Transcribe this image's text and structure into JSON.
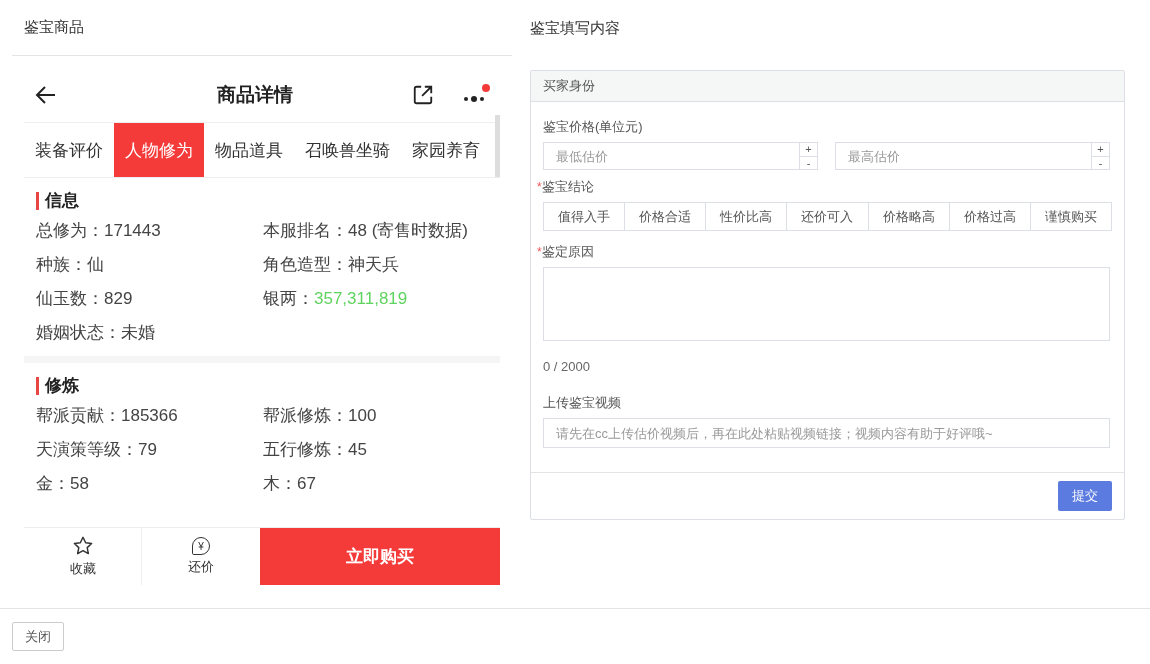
{
  "left_panel": {
    "title": "鉴宝商品"
  },
  "phone": {
    "title": "商品详情",
    "more_badge": true,
    "tabs": [
      {
        "label": "装备评价",
        "selected": false
      },
      {
        "label": "人物修为",
        "selected": true
      },
      {
        "label": "物品道具",
        "selected": false
      },
      {
        "label": "召唤兽坐骑",
        "selected": false
      },
      {
        "label": "家园养育",
        "selected": false
      }
    ],
    "sections": [
      {
        "title": "信息",
        "items": [
          {
            "label": "总修为：",
            "value": "171443"
          },
          {
            "label": "本服排名：",
            "value": "48 (寄售时数据)"
          },
          {
            "label": "种族：",
            "value": "仙"
          },
          {
            "label": "角色造型：",
            "value": "神天兵"
          },
          {
            "label": "仙玉数：",
            "value": "829"
          },
          {
            "label": "银两：",
            "value": "357,311,819",
            "color": "#5fd35f"
          },
          {
            "label": "婚姻状态：",
            "value": "未婚"
          }
        ]
      },
      {
        "title": "修炼",
        "items": [
          {
            "label": "帮派贡献：",
            "value": "185366"
          },
          {
            "label": "帮派修炼：",
            "value": "100"
          },
          {
            "label": "天演策等级：",
            "value": "79"
          },
          {
            "label": "五行修炼：",
            "value": "45"
          },
          {
            "label": "金：",
            "value": "58"
          },
          {
            "label": "木：",
            "value": "67"
          }
        ]
      }
    ],
    "actions": [
      {
        "kind": "favorite",
        "label": "收藏"
      },
      {
        "kind": "bargain",
        "label": "还价",
        "symbol": "¥"
      }
    ],
    "buy_button": "立即购买"
  },
  "right_panel": {
    "title": "鉴宝填写内容",
    "card": {
      "header": "买家身份",
      "price": {
        "label": "鉴宝价格(单位元)",
        "fields": [
          {
            "placeholder": "最低估价",
            "up": "+",
            "down": "-"
          },
          {
            "placeholder": "最高估价",
            "up": "+",
            "down": "-"
          }
        ]
      },
      "conclusion": {
        "required_mark": "*",
        "label": "鉴宝结论",
        "options": [
          {
            "label": "值得入手",
            "selected": false
          },
          {
            "label": "价格合适",
            "selected": false
          },
          {
            "label": "性价比高",
            "selected": false
          },
          {
            "label": "还价可入",
            "selected": false
          },
          {
            "label": "价格略高",
            "selected": false
          },
          {
            "label": "价格过高",
            "selected": false
          },
          {
            "label": "谨慎购买",
            "selected": false
          }
        ]
      },
      "reason": {
        "required_mark": "*",
        "label": "鉴定原因",
        "counter": "0 / 2000"
      },
      "video": {
        "label": "上传鉴宝视频",
        "placeholder": "请先在cc上传估价视频后，再在此处粘贴视频链接；视频内容有助于好评哦~"
      },
      "submit": "提交"
    }
  },
  "footer": {
    "close_button": "关闭"
  }
}
